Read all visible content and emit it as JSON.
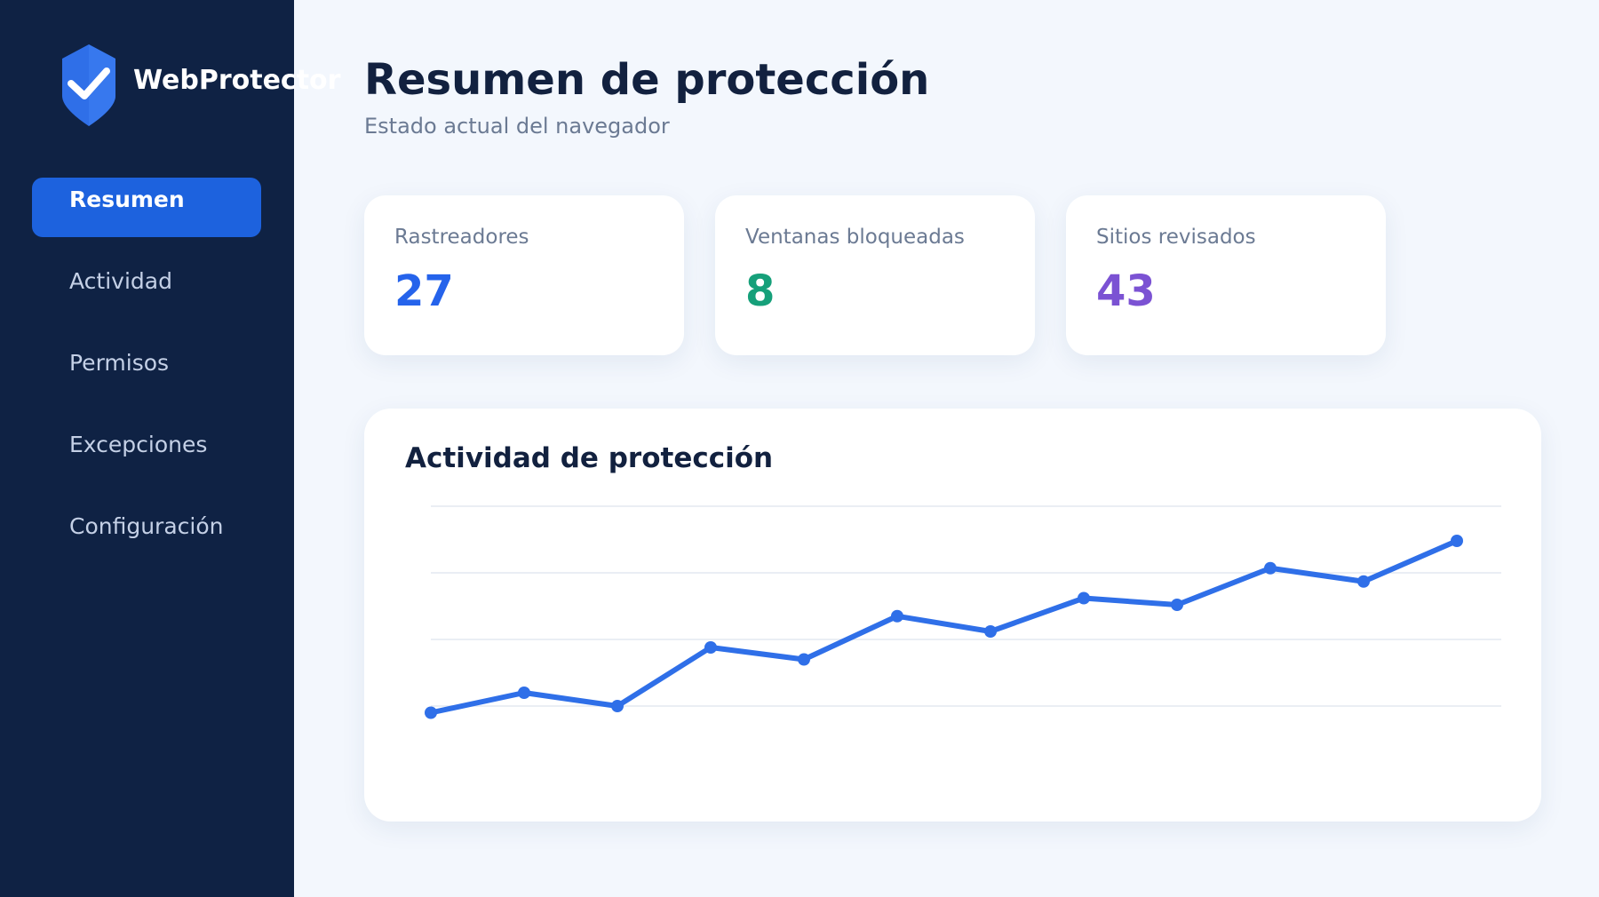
{
  "app": {
    "name": "WebProtector",
    "logo_icon": "shield-check-icon"
  },
  "sidebar": {
    "items": [
      {
        "label": "Resumen",
        "active": true
      },
      {
        "label": "Actividad",
        "active": false
      },
      {
        "label": "Permisos",
        "active": false
      },
      {
        "label": "Excepciones",
        "active": false
      },
      {
        "label": "Configuración",
        "active": false
      }
    ]
  },
  "header": {
    "title": "Resumen de protección",
    "subtitle": "Estado actual del navegador"
  },
  "stats": [
    {
      "label": "Rastreadores",
      "value": "27",
      "color": "#2563eb"
    },
    {
      "label": "Ventanas bloqueadas",
      "value": "8",
      "color": "#16a07a"
    },
    {
      "label": "Sitios revisados",
      "value": "43",
      "color": "#7b52d3"
    }
  ],
  "activity": {
    "title": "Actividad de protección"
  },
  "chart_data": {
    "type": "line",
    "title": "Actividad de protección",
    "xlabel": "",
    "ylabel": "",
    "grid": true,
    "color": "#2f6fe8",
    "ylim": [
      0,
      3
    ],
    "gridlines": [
      0,
      1,
      2,
      3
    ],
    "series": [
      {
        "values": [
          -0.1,
          0.2,
          0.0,
          0.88,
          0.7,
          1.35,
          1.12,
          1.62,
          1.52,
          2.07,
          1.87,
          2.48
        ]
      }
    ]
  },
  "colors": {
    "sidebar_bg": "#0f2244",
    "accent": "#1d62de",
    "page_bg": "#f3f7fd"
  }
}
